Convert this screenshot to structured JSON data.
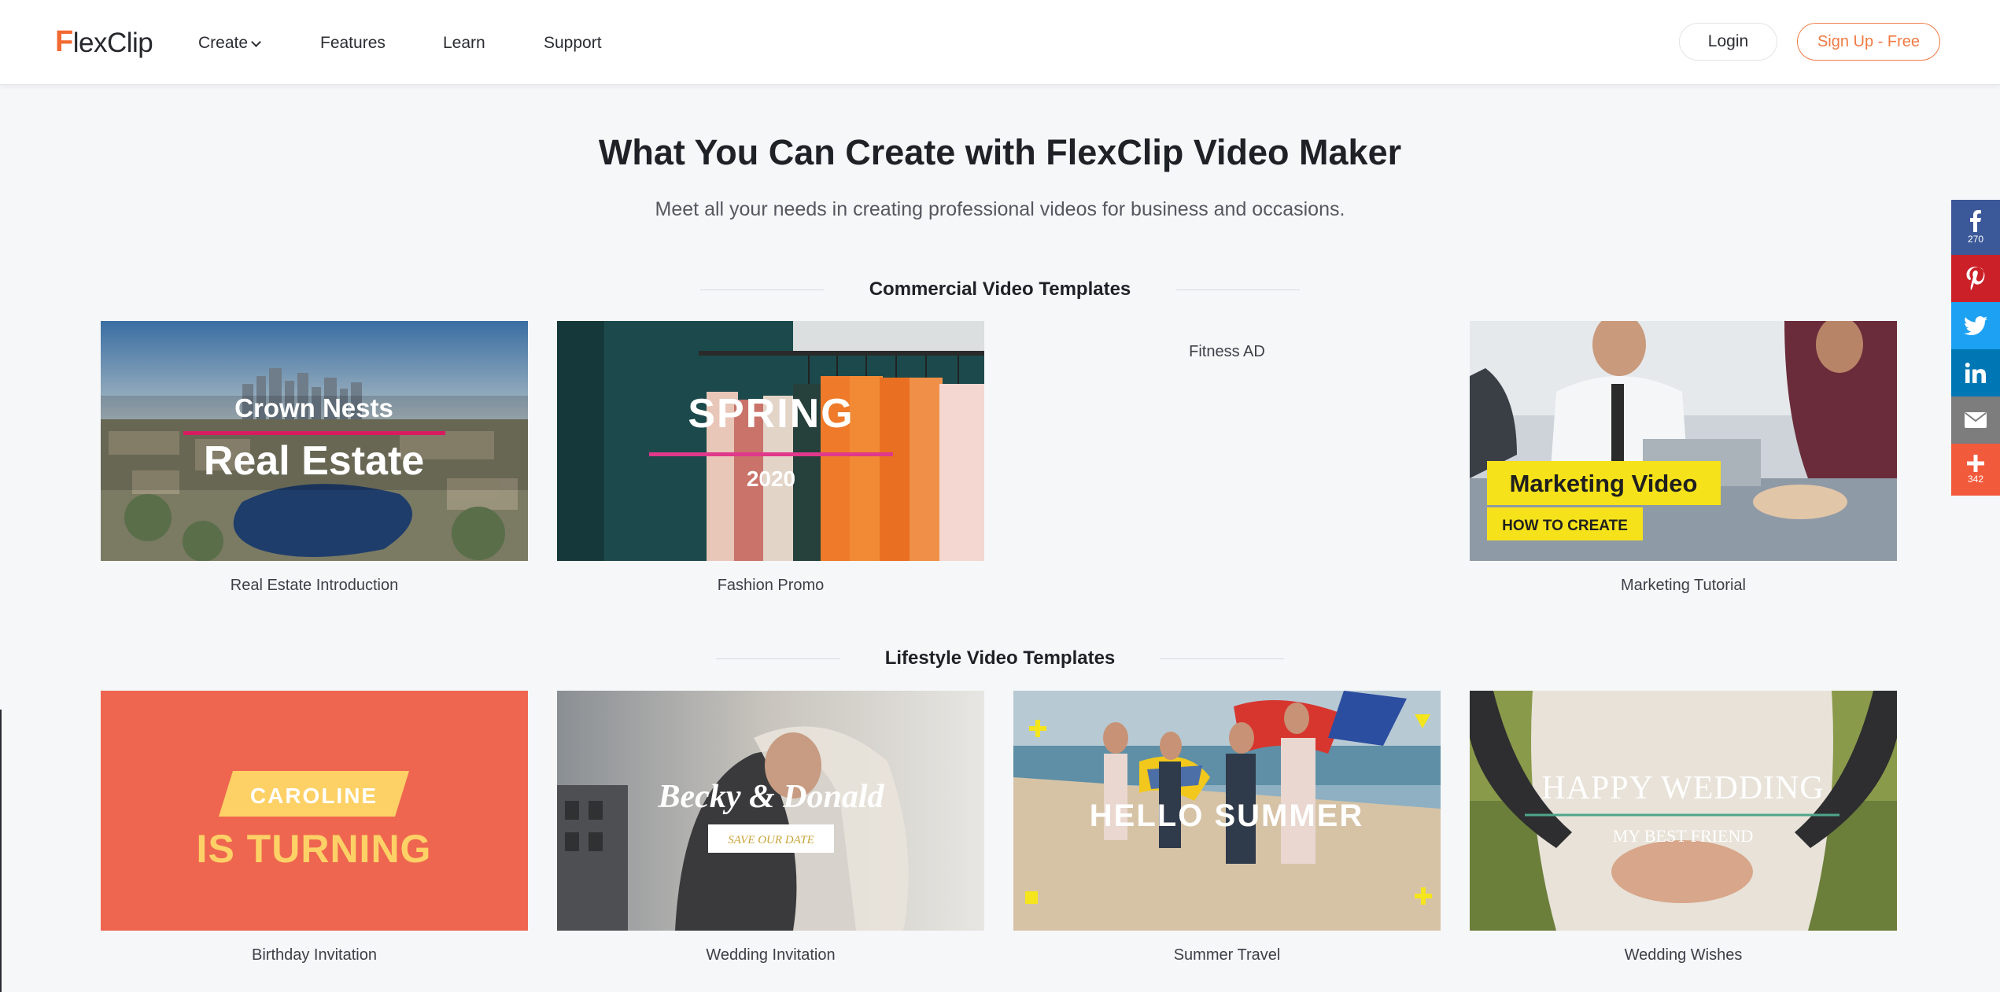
{
  "header": {
    "logo_f": "F",
    "logo_rest": "lexClip",
    "nav": {
      "create": "Create",
      "features": "Features",
      "learn": "Learn",
      "support": "Support"
    },
    "login": "Login",
    "signup": "Sign Up - Free"
  },
  "hero": {
    "title": "What You Can Create with FlexClip Video Maker",
    "subtitle": "Meet all your needs in creating professional videos for business and occasions."
  },
  "commercial": {
    "heading": "Commercial Video Templates",
    "cards": [
      {
        "caption": "Real Estate Introduction",
        "overlay_top": "Crown Nests",
        "overlay_main": "Real Estate"
      },
      {
        "caption": "Fashion Promo",
        "overlay_top": "SPRING",
        "overlay_main": "2020"
      },
      {
        "caption": "Fitness AD"
      },
      {
        "caption": "Marketing Tutorial",
        "overlay_top": "Marketing Video",
        "overlay_main": "HOW TO CREATE"
      }
    ]
  },
  "lifestyle": {
    "heading": "Lifestyle Video Templates",
    "cards": [
      {
        "caption": "Birthday Invitation",
        "overlay_top": "CAROLINE",
        "overlay_main": "IS TURNING"
      },
      {
        "caption": "Wedding Invitation",
        "overlay_top": "Becky & Donald",
        "overlay_main": "SAVE OUR DATE"
      },
      {
        "caption": "Summer Travel",
        "overlay_top": "HELLO SUMMER"
      },
      {
        "caption": "Wedding Wishes",
        "overlay_top": "HAPPY WEDDING",
        "overlay_main": "MY BEST FRIEND"
      }
    ]
  },
  "social": {
    "facebook_count": "270",
    "more_count": "342",
    "icons": [
      "facebook-icon",
      "pinterest-icon",
      "twitter-icon",
      "linkedin-icon",
      "email-icon",
      "plus-icon"
    ]
  },
  "colors": {
    "accent": "#f07a43",
    "facebook": "#3b5998",
    "pinterest": "#cb2027",
    "twitter": "#1da1f2",
    "linkedin": "#0077b5",
    "email": "#7d7d7d",
    "more": "#f25a3c"
  }
}
